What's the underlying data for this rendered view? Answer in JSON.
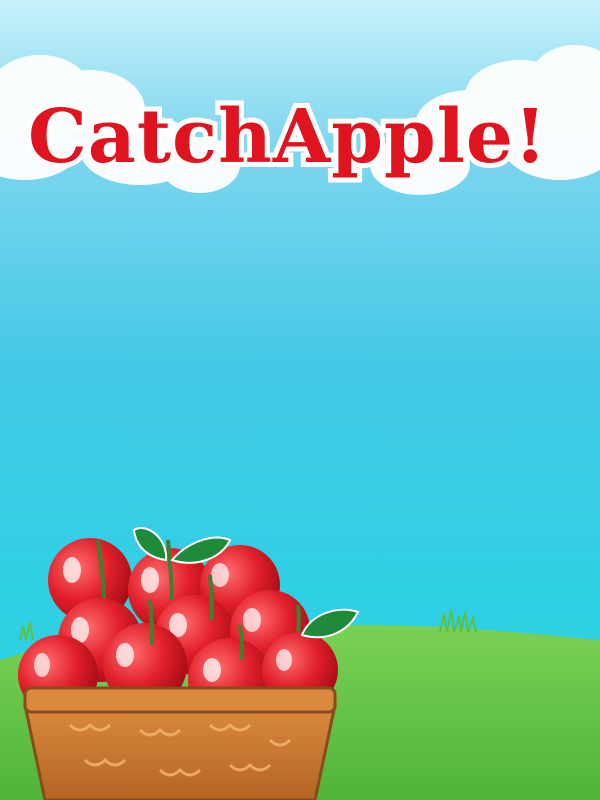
{
  "game": {
    "title": "CatchApple!"
  },
  "colors": {
    "sky_top": "#c7f1fb",
    "sky_bottom": "#2ad3e0",
    "grass": "#6cc84a",
    "apple_red": "#e11f2b",
    "leaf_green": "#1f8a3a",
    "basket_brown": "#c9792f",
    "title_red": "#e0141e",
    "title_outline": "#ffffff"
  },
  "icons": {
    "apples": "apple-icon",
    "basket": "basket-icon",
    "clouds": "cloud-icon"
  }
}
